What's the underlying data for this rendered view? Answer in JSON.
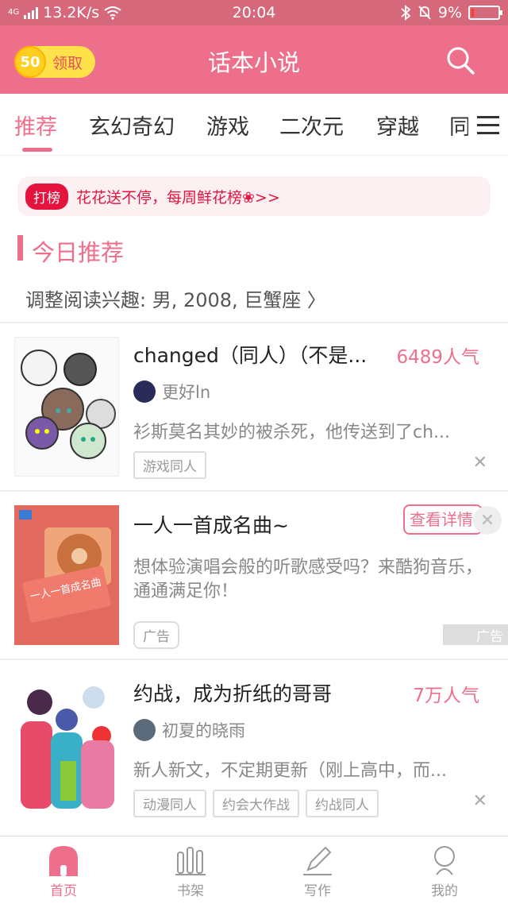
{
  "status_bar": {
    "network": "4G",
    "speed": "13.2K/s",
    "time": "20:04",
    "battery": "9%",
    "battery_level": 0.09
  },
  "header": {
    "coin_value": "50",
    "coin_label": "领取",
    "title": "话本小说",
    "accent": "#ee6f8b"
  },
  "tabs": {
    "items": [
      "推荐",
      "玄幻奇幻",
      "游戏",
      "二次元",
      "穿越",
      "同"
    ],
    "active": 0
  },
  "banner": {
    "tag": "打榜",
    "text": "花花送不停，每周鲜花榜❀>>"
  },
  "section": {
    "title": "今日推荐",
    "interest": "调整阅读兴趣: 男, 2008, 巨蟹座 〉"
  },
  "books": [
    {
      "title": "changed（同人）（不是...",
      "popularity": "6489人气",
      "author": "更好ln",
      "description": "衫斯莫名其妙的被杀死，他传送到了ch...",
      "tags": [
        "游戏同人"
      ]
    },
    {
      "title": "约战，成为折纸的哥哥",
      "popularity": "7万人气",
      "author": "初夏的晓雨",
      "description": "新人新文，不定期更新（刚上高中，而...",
      "tags": [
        "动漫同人",
        "约会大作战",
        "约战同人"
      ]
    }
  ],
  "ad": {
    "title": "一人一首成名曲~",
    "description": "想体验演唱会般的听歌感受吗？来酷狗音乐，通通满足你！",
    "tag": "广告",
    "detail_button": "查看详情",
    "ad_mark": "广告",
    "cover_text": "一人一首成名曲"
  },
  "bottom_nav": {
    "items": [
      "首页",
      "书架",
      "写作",
      "我的"
    ],
    "active": 0
  },
  "icons": {
    "search": "search-icon",
    "menu": "menu-icon",
    "close": "close-icon",
    "home": "home-icon",
    "bookshelf": "bookshelf-icon",
    "write": "pen-icon",
    "profile": "user-icon"
  }
}
